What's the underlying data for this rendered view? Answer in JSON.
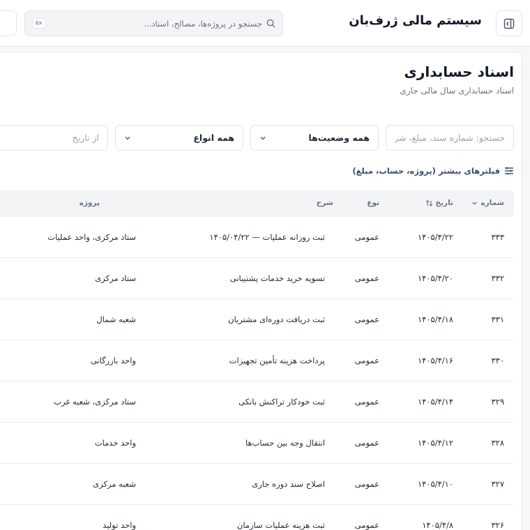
{
  "header": {
    "app_title": "سیستم مالی ژرف‌بان",
    "search_placeholder": "جستجو در پروژه‌ها، مصالح، اسناد...",
    "shortcut": "K⌘"
  },
  "page": {
    "title": "اسناد حسابداری",
    "subtitle": "اسناد حسابداری سال مالی جاری"
  },
  "filters": {
    "search_placeholder": "جستجو: شماره سند، مبلغ، شرح",
    "status": "همه وضعیت‌ها",
    "types": "همه انواع",
    "date_from_placeholder": "از تاریخ",
    "more_filters": "فیلترهای بیشتر (پروژه، حساب، مبلغ)"
  },
  "table": {
    "columns": {
      "number": "شماره",
      "date": "تاریخ",
      "type": "نوع",
      "description": "شرح",
      "project": "پروژه"
    },
    "rows": [
      {
        "number": "۳۳۳",
        "date": "۱۴۰۵/۴/۲۲",
        "type": "عمومی",
        "description": "ثبت روزانه عملیات — ۱۴۰۵/۰۴/۲۲",
        "project": "ستاد مرکزی، واحد عملیات"
      },
      {
        "number": "۳۳۲",
        "date": "۱۴۰۵/۴/۲۰",
        "type": "عمومی",
        "description": "تسویه خرید خدمات پشتیبانی",
        "project": "ستاد مرکزی"
      },
      {
        "number": "۳۳۱",
        "date": "۱۴۰۵/۴/۱۸",
        "type": "عمومی",
        "description": "ثبت دریافت دوره‌ای مشتریان",
        "project": "شعبه شمال"
      },
      {
        "number": "۳۳۰",
        "date": "۱۴۰۵/۴/۱۶",
        "type": "عمومی",
        "description": "پرداخت هزینه تأمین تجهیزات",
        "project": "واحد بازرگانی"
      },
      {
        "number": "۳۲۹",
        "date": "۱۴۰۵/۴/۱۴",
        "type": "عمومی",
        "description": "ثبت خودکار تراکنش بانکی",
        "project": "ستاد مرکزی، شعبه غرب"
      },
      {
        "number": "۳۲۸",
        "date": "۱۴۰۵/۴/۱۲",
        "type": "عمومی",
        "description": "انتقال وجه بین حساب‌ها",
        "project": "واحد خدمات"
      },
      {
        "number": "۳۲۷",
        "date": "۱۴۰۵/۴/۱۰",
        "type": "عمومی",
        "description": "اصلاح سند دوره جاری",
        "project": "شعبه مرکزی"
      },
      {
        "number": "۳۲۶",
        "date": "۱۴۰۵/۴/۸",
        "type": "عمومی",
        "description": "ثبت هزینه عملیات سازمان",
        "project": "واحد تولید"
      }
    ]
  }
}
